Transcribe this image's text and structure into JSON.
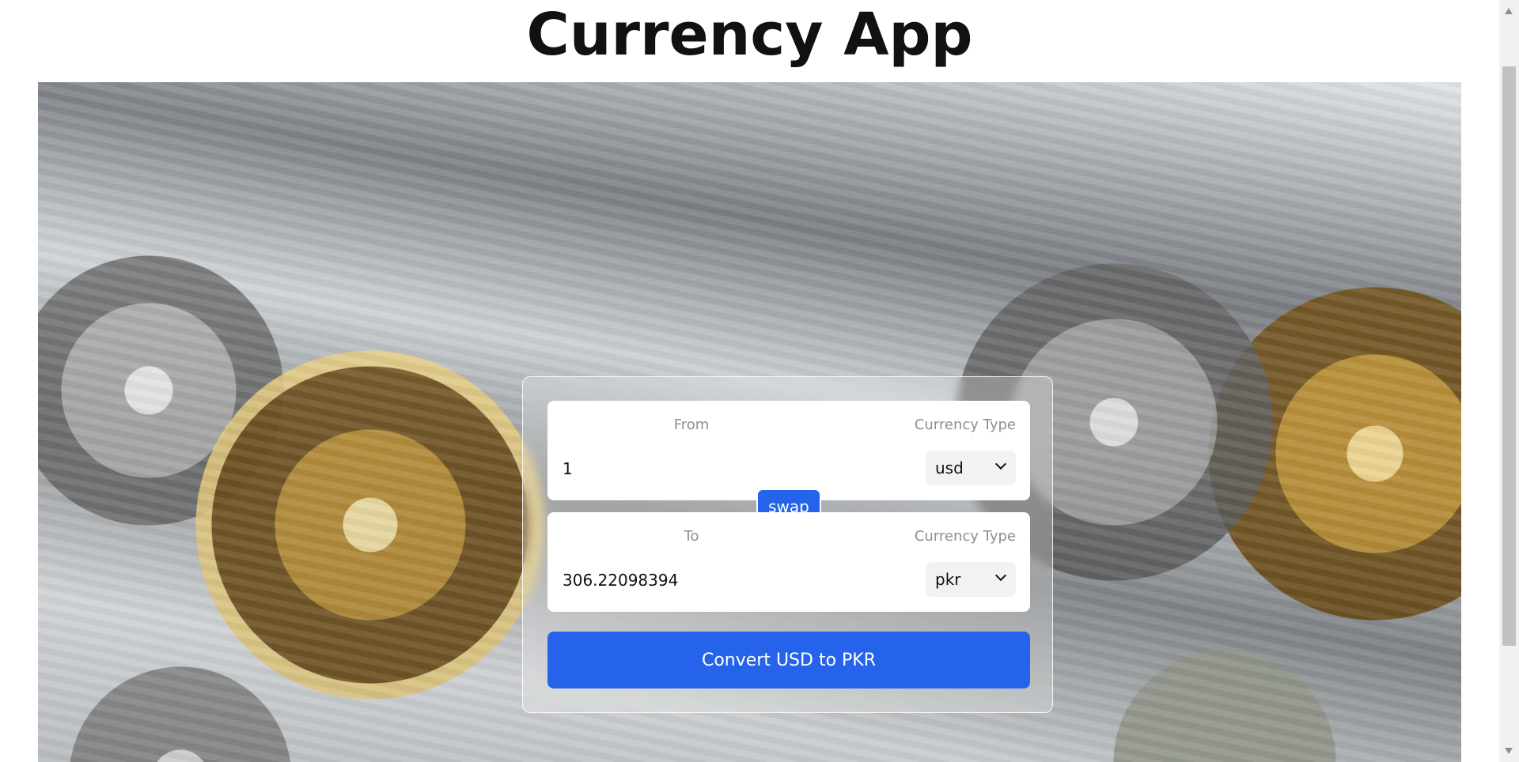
{
  "app": {
    "title": "Currency App"
  },
  "converter": {
    "from": {
      "label": "From",
      "currency_label": "Currency Type",
      "amount": "1",
      "currency": "usd"
    },
    "to": {
      "label": "To",
      "currency_label": "Currency Type",
      "amount": "306.22098394",
      "currency": "pkr"
    },
    "swap_label": "swap",
    "convert_label": "Convert USD to PKR"
  },
  "icons": {
    "chevron": "chevron-down-icon",
    "scroll_up": "arrow-up-icon",
    "scroll_down": "arrow-down-icon"
  },
  "colors": {
    "primary": "#2563eb",
    "card": "#ffffff",
    "muted_text": "#8f8f8f"
  }
}
